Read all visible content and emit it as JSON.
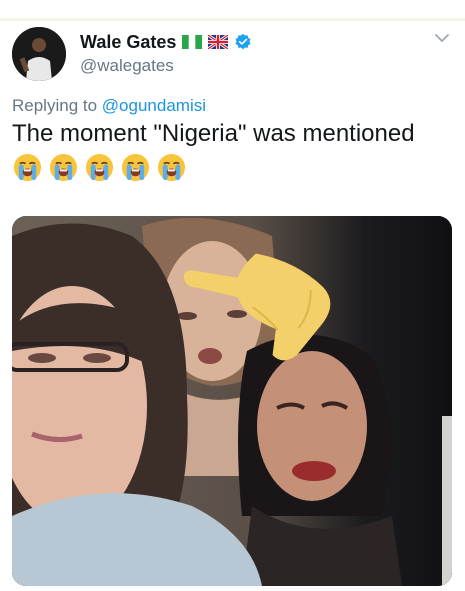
{
  "tweet": {
    "display_name": "Wale Gates",
    "handle": "@walegates",
    "replying_prefix": "Replying to",
    "replying_to": "@ogundamisi",
    "text": "The moment \"Nigeria\" was mentioned",
    "emoji": [
      "loudly-crying-face",
      "loudly-crying-face",
      "loudly-crying-face",
      "loudly-crying-face",
      "loudly-crying-face"
    ],
    "flags": [
      "nigeria-flag",
      "uk-flag"
    ],
    "verified": true
  },
  "colors": {
    "text": "#14171a",
    "secondary": "#657786",
    "link": "#1b95e0",
    "verified": "#1da1f2",
    "emoji_yellow": "#f7c43b",
    "tears": "#5dadec"
  }
}
